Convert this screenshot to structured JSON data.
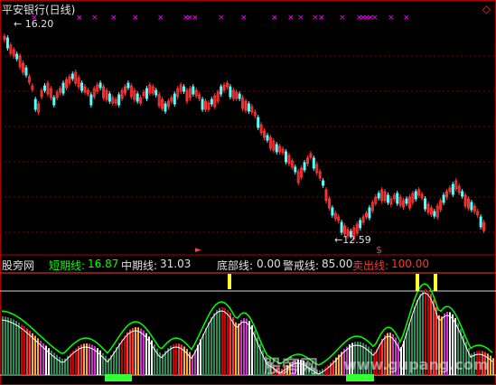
{
  "window": {
    "title": "平安银行(日线)"
  },
  "price_panel": {
    "high_label": "16.20",
    "low_label": "12.59",
    "high_arrow": "←",
    "low_arrow": "←",
    "up_color": "#ff3333",
    "down_color": "#54ffff",
    "marker_color": "#ff00ff",
    "sell_marker": "$"
  },
  "indicator_panel": {
    "name": "股旁网",
    "items": [
      {
        "label": "短期线:",
        "value": "16.87",
        "color": "#00ff00"
      },
      {
        "label": "中期线:",
        "value": "31.03",
        "color": "#e0e0e0"
      },
      {
        "label": "底部线:",
        "value": "0.00",
        "color": "#e0e0e0"
      },
      {
        "label": "警戒线:",
        "value": "85.00",
        "color": "#e0e0e0"
      },
      {
        "label": "卖出线:",
        "value": "100.00",
        "color": "#ff3333"
      }
    ]
  },
  "watermark": {
    "text": "股旁网",
    "url": "www.gupang.com"
  },
  "icons": {
    "corner": "diamond-icon"
  }
}
